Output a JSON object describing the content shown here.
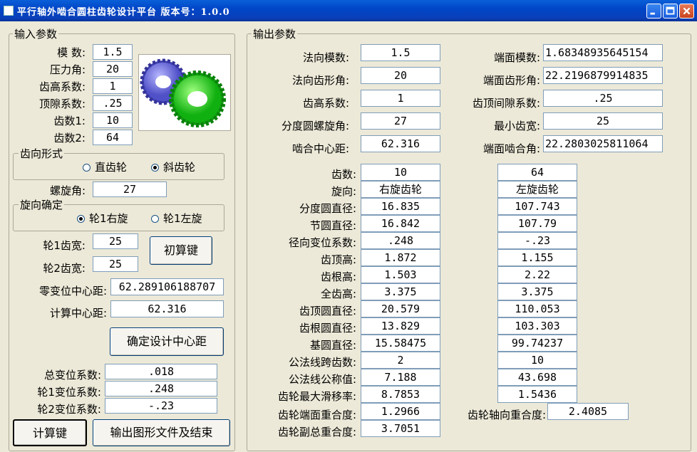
{
  "window": {
    "title": "平行轴外啮合圆柱齿轮设计平台 版本号：1.0.0"
  },
  "input": {
    "legend": "输入参数",
    "module_label": "模  数:",
    "module_value": "1.5",
    "pressure_label": "压力角:",
    "pressure_value": "20",
    "addendum_label": "齿高系数:",
    "addendum_value": "1",
    "clearance_label": "顶隙系数:",
    "clearance_value": ".25",
    "z1_label": "齿数1:",
    "z1_value": "10",
    "z2_label": "齿数2:",
    "z2_value": "64",
    "tooth_form": {
      "legend": "齿向形式",
      "spur": "直齿轮",
      "helical": "斜齿轮",
      "selected": "helical"
    },
    "helix_label": "螺旋角:",
    "helix_value": "27",
    "hand": {
      "legend": "旋向确定",
      "right": "轮1右旋",
      "left": "轮1左旋",
      "selected": "right"
    },
    "b1_label": "轮1齿宽:",
    "b1_value": "25",
    "b2_label": "轮2齿宽:",
    "b2_value": "25",
    "initcalc_button": "初算键",
    "zero_center_label": "零变位中心距:",
    "zero_center_value": "62.289106188707",
    "calc_center_label": "计算中心距:",
    "calc_center_value": "62.316",
    "confirm_button": "确定设计中心距",
    "total_shift_label": "总变位系数:",
    "total_shift_value": ".018",
    "shift1_label": "轮1变位系数:",
    "shift1_value": ".248",
    "shift2_label": "轮2变位系数:",
    "shift2_value": "-.23",
    "calc_button": "计算键",
    "export_button": "输出图形文件及结束"
  },
  "output": {
    "legend": "输出参数",
    "normal_module_label": "法向模数:",
    "normal_module_value": "1.5",
    "transverse_module_label": "端面模数:",
    "transverse_module_value": "1.68348935645154",
    "normal_angle_label": "法向齿形角:",
    "normal_angle_value": "20",
    "transverse_angle_label": "端面齿形角:",
    "transverse_angle_value": "22.2196879914835",
    "addendum_coef_label": "齿高系数:",
    "addendum_coef_value": "1",
    "clearance_coef_label": "齿顶间隙系数:",
    "clearance_coef_value": ".25",
    "helix_angle_label": "分度圆螺旋角:",
    "helix_angle_value": "27",
    "min_width_label": "最小齿宽:",
    "min_width_value": "25",
    "center_label": "啮合中心距:",
    "center_value": "62.316",
    "transverse_mesh_label": "端面啮合角:",
    "transverse_mesh_value": "22.2803025811064",
    "table": {
      "labels": [
        "齿数:",
        "旋向:",
        "分度圆直径:",
        "节圆直径:",
        "径向变位系数:",
        "齿顶高:",
        "齿根高:",
        "全齿高:",
        "齿顶圆直径:",
        "齿根圆直径:",
        "基圆直径:",
        "公法线跨齿数:",
        "公法线公称值:",
        "齿轮最大滑移率:"
      ],
      "gear1": [
        "10",
        "右旋齿轮",
        "16.835",
        "16.842",
        ".248",
        "1.872",
        "1.503",
        "3.375",
        "20.579",
        "13.829",
        "15.58475",
        "2",
        "7.188",
        "8.7853"
      ],
      "gear2": [
        "64",
        "左旋齿轮",
        "107.743",
        "107.79",
        "-.23",
        "1.155",
        "2.22",
        "3.375",
        "110.053",
        "103.303",
        "99.74237",
        "10",
        "43.698",
        "1.5436"
      ]
    },
    "transverse_contact_label": "齿轮端面重合度:",
    "transverse_contact_value": "1.2966",
    "axial_contact_label": "齿轮轴向重合度:",
    "axial_contact_value": "2.4085",
    "total_contact_label": "齿轮副总重合度:",
    "total_contact_value": "3.7051"
  }
}
